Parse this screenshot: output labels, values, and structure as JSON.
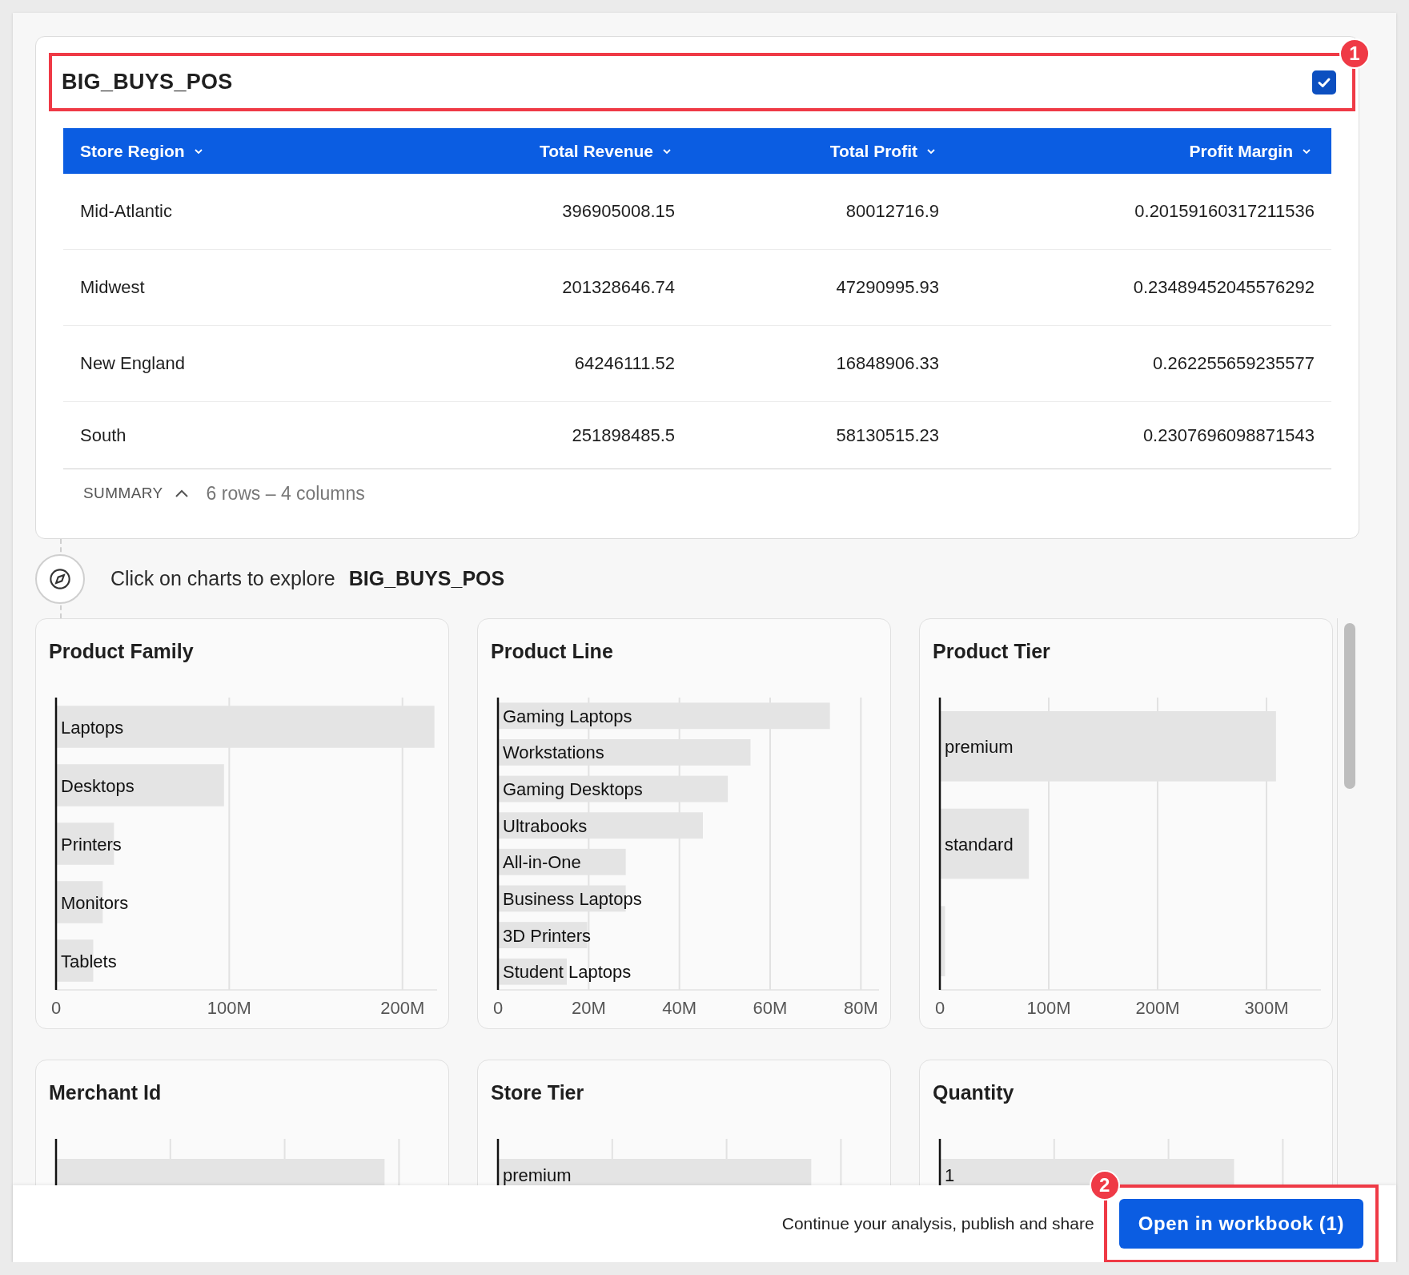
{
  "source_panel": {
    "title": "BIG_BUYS_POS",
    "checked": true,
    "badge": "1",
    "table": {
      "columns": [
        "Store Region",
        "Total Revenue",
        "Total Profit",
        "Profit Margin"
      ],
      "rows": [
        [
          "Mid-Atlantic",
          "396905008.15",
          "80012716.9",
          "0.20159160317211536"
        ],
        [
          "Midwest",
          "201328646.74",
          "47290995.93",
          "0.23489452045576292"
        ],
        [
          "New England",
          "64246111.52",
          "16848906.33",
          "0.262255659235577"
        ],
        [
          "South",
          "251898485.5",
          "58130515.23",
          "0.2307696098871543"
        ]
      ]
    },
    "summary": {
      "label": "SUMMARY",
      "text": "6 rows – 4 columns"
    }
  },
  "explore": {
    "text": "Click on charts to explore",
    "source": "BIG_BUYS_POS"
  },
  "charts": [
    {
      "title": "Product Family",
      "chart_data": {
        "type": "bar",
        "orientation": "horizontal",
        "categories": [
          "Laptops",
          "Desktops",
          "Printers",
          "Monitors",
          "Tablets"
        ],
        "values": [
          218000000,
          96500000,
          33000000,
          26500000,
          21000000
        ],
        "grid": true,
        "xlim": [
          0,
          220000000
        ],
        "xticks": [
          {
            "value": 0,
            "label": "0"
          },
          {
            "value": 100000000,
            "label": "100M"
          },
          {
            "value": 200000000,
            "label": "200M"
          }
        ]
      }
    },
    {
      "title": "Product Line",
      "chart_data": {
        "type": "bar",
        "orientation": "horizontal",
        "categories": [
          "Gaming Laptops",
          "Workstations",
          "Gaming Desktops",
          "Ultrabooks",
          "All-in-One",
          "Business Laptops",
          "3D Printers",
          "Student Laptops"
        ],
        "values": [
          73000000,
          55500000,
          50500000,
          45000000,
          28000000,
          28000000,
          19500000,
          15000000
        ],
        "grid": true,
        "xlim": [
          0,
          84000000
        ],
        "xticks": [
          {
            "value": 0,
            "label": "0"
          },
          {
            "value": 20000000,
            "label": "20M"
          },
          {
            "value": 40000000,
            "label": "40M"
          },
          {
            "value": 60000000,
            "label": "60M"
          },
          {
            "value": 80000000,
            "label": "80M"
          }
        ]
      }
    },
    {
      "title": "Product Tier",
      "chart_data": {
        "type": "bar",
        "orientation": "horizontal",
        "categories": [
          "premium",
          "standard",
          null
        ],
        "values": [
          308000000,
          81000000,
          4000000
        ],
        "grid": true,
        "xlim": [
          0,
          350000000
        ],
        "xticks": [
          {
            "value": 0,
            "label": "0"
          },
          {
            "value": 100000000,
            "label": "100M"
          },
          {
            "value": 200000000,
            "label": "200M"
          },
          {
            "value": 300000000,
            "label": "300M"
          }
        ]
      }
    },
    {
      "title": "Merchant Id",
      "preview_bars": [
        {
          "level": 0.86
        }
      ]
    },
    {
      "title": "Store Tier",
      "preview_bars": [
        {
          "label": "premium",
          "level": 0.82
        }
      ]
    },
    {
      "title": "Quantity",
      "preview_bars": [
        {
          "label": "1",
          "level": 0.77
        }
      ]
    }
  ],
  "footer": {
    "text": "Continue your analysis, publish and share",
    "button": "Open in workbook (1)",
    "badge": "2"
  }
}
